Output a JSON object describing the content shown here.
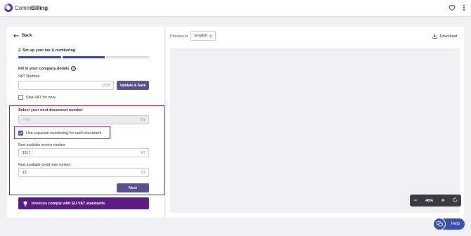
{
  "app": {
    "brand_light": "Comm",
    "brand_bold": "Billing"
  },
  "nav": {
    "back_label": "Back"
  },
  "step": {
    "title": "2. Set up your tax & numbering",
    "progress_segments": [
      "done",
      "done",
      "todo"
    ]
  },
  "company": {
    "title": "Fill in your company details",
    "vat_label": "VAT Number",
    "vat_value": "",
    "vat_counter": "12/20",
    "validate_label": "Validate & Save",
    "skip_label": "Skip VAT for now",
    "skip_checked": false
  },
  "numbering": {
    "title": "Select your next document number",
    "doc_placeholder": "#000",
    "doc_counter": "0/7",
    "separate_label": "Use separate numbering for each document",
    "separate_checked": true,
    "invoice_label": "Next available invoice number",
    "invoice_value": "1017",
    "invoice_counter": "4/7",
    "credit_label": "Next available credit note number",
    "credit_value": "13",
    "credit_counter": "2/7",
    "next_label": "Next"
  },
  "banner": {
    "text": "Invoices comply with EU VAT standards."
  },
  "preview": {
    "label": "Preview in",
    "language": "English",
    "download_label": "Download",
    "zoom": "48%"
  },
  "help": {
    "label": "Help"
  },
  "colors": {
    "accent": "#5a4f8e",
    "highlight": "#7a2196",
    "banner": "#5b1d84",
    "progress_done": "#3e4576",
    "progress_todo": "#dcdce2",
    "help": "#3a4eaa"
  },
  "icons": [
    "heart-icon",
    "kebab-icon",
    "back-arrow-icon",
    "info-icon",
    "check-icon",
    "bulb-icon",
    "sort-icon",
    "download-icon",
    "minus-icon",
    "plus-icon",
    "reset-icon",
    "chat-icon"
  ]
}
